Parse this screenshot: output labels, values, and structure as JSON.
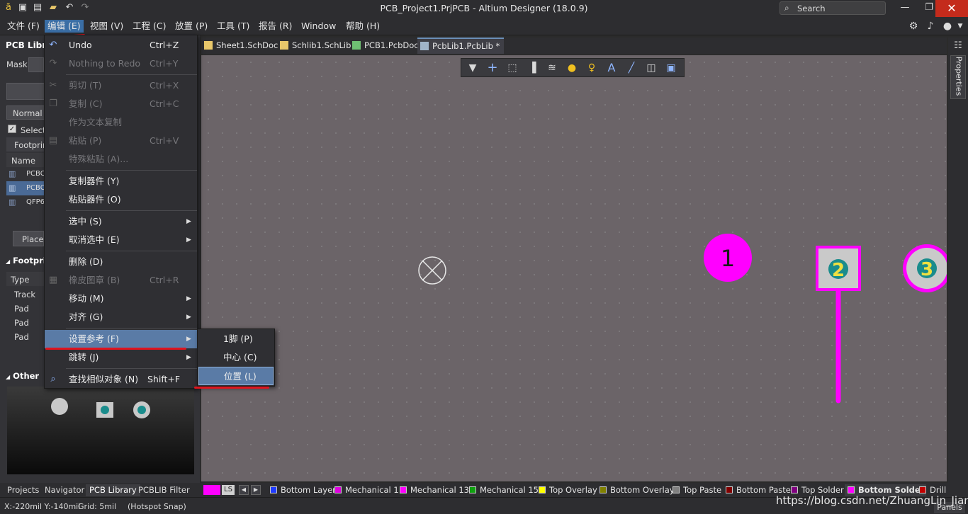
{
  "window": {
    "title": "PCB_Project1.PrjPCB - Altium Designer (18.0.9)",
    "search_placeholder": "Search",
    "minimize": "—",
    "maximize": "❐",
    "close": "✕"
  },
  "menubar": {
    "items": [
      {
        "label": "文件 (F)"
      },
      {
        "label": "编辑 (E)"
      },
      {
        "label": "视图 (V)"
      },
      {
        "label": "工程 (C)"
      },
      {
        "label": "放置 (P)"
      },
      {
        "label": "工具 (T)"
      },
      {
        "label": "报告 (R)"
      },
      {
        "label": "Window"
      },
      {
        "label": "帮助 (H)"
      }
    ]
  },
  "left_panel": {
    "title": "PCB Libra",
    "mask_label": "Mask",
    "normal_label": "Normal",
    "select_label": "Select",
    "footprints_header": "Footprin",
    "name_col": "Name",
    "footprints": [
      "PCBC",
      "PCBC",
      "QFP6"
    ],
    "place_button": "Place",
    "footprint_prims_title": "Footprin",
    "type_col": "Type",
    "primitives": [
      "Track",
      "Pad",
      "Pad",
      "Pad"
    ],
    "other_title": "Other"
  },
  "doc_tabs": [
    {
      "label": "Sheet1.SchDoc",
      "color": "#e8c76a"
    },
    {
      "label": "Schlib1.SchLib",
      "color": "#e8c76a"
    },
    {
      "label": "PCB1.PcbDoc",
      "color": "#6fbf73"
    },
    {
      "label": "PcbLib1.PcbLib *",
      "color": "#a0b4c8"
    }
  ],
  "edit_menu": {
    "items": [
      {
        "label": "Undo",
        "shortcut": "Ctrl+Z",
        "icon": "undo-icon",
        "disabled": false
      },
      {
        "label": "Nothing to Redo",
        "shortcut": "Ctrl+Y",
        "icon": "redo-icon",
        "disabled": true
      },
      {
        "label": "剪切 (T)",
        "shortcut": "Ctrl+X",
        "icon": "cut-icon",
        "disabled": true
      },
      {
        "label": "复制 (C)",
        "shortcut": "Ctrl+C",
        "icon": "copy-icon",
        "disabled": true
      },
      {
        "label": "作为文本复制",
        "shortcut": "",
        "disabled": true
      },
      {
        "label": "粘贴 (P)",
        "shortcut": "Ctrl+V",
        "icon": "paste-icon",
        "disabled": true
      },
      {
        "label": "特殊粘贴 (A)...",
        "shortcut": "",
        "disabled": true
      },
      {
        "label": "复制器件 (Y)",
        "shortcut": "",
        "disabled": false
      },
      {
        "label": "粘贴器件 (O)",
        "shortcut": "",
        "disabled": false
      },
      {
        "label": "选中 (S)",
        "shortcut": "",
        "submenu": true,
        "disabled": false
      },
      {
        "label": "取消选中 (E)",
        "shortcut": "",
        "submenu": true,
        "disabled": false
      },
      {
        "label": "删除 (D)",
        "shortcut": "",
        "disabled": false
      },
      {
        "label": "橡皮图章 (B)",
        "shortcut": "Ctrl+R",
        "icon": "stamp-icon",
        "disabled": true
      },
      {
        "label": "移动 (M)",
        "shortcut": "",
        "submenu": true,
        "disabled": false
      },
      {
        "label": "对齐 (G)",
        "shortcut": "",
        "submenu": true,
        "disabled": false
      },
      {
        "label": "设置参考 (F)",
        "shortcut": "",
        "submenu": true,
        "disabled": false
      },
      {
        "label": "跳转 (J)",
        "shortcut": "",
        "submenu": true,
        "disabled": false
      },
      {
        "label": "查找相似对象 (N)",
        "shortcut": "Shift+F",
        "icon": "find-similar-icon",
        "disabled": false
      }
    ]
  },
  "submenu": {
    "items": [
      {
        "label": "1脚 (P)"
      },
      {
        "label": "中心 (C)"
      },
      {
        "label": "位置 (L)"
      }
    ]
  },
  "canvas": {
    "pad1_label": "1",
    "pad2_label": "2",
    "pad3_label": "3",
    "pad_color": "#ff00ff"
  },
  "bottom_tabs": [
    "Projects",
    "Navigator",
    "PCB Library",
    "PCBLIB Filter"
  ],
  "layers": {
    "current": "LS",
    "items": [
      {
        "label": "Bottom Layer",
        "color": "#1f3bff"
      },
      {
        "label": "Mechanical 1",
        "color": "#e000e0"
      },
      {
        "label": "Mechanical 13",
        "color": "#ff00ff"
      },
      {
        "label": "Mechanical 15",
        "color": "#10a010"
      },
      {
        "label": "Top Overlay",
        "color": "#ffff00"
      },
      {
        "label": "Bottom Overlay",
        "color": "#808000"
      },
      {
        "label": "Top Paste",
        "color": "#808080"
      },
      {
        "label": "Bottom Paste",
        "color": "#800000"
      },
      {
        "label": "Top Solder",
        "color": "#800080"
      },
      {
        "label": "Bottom Solder",
        "color": "#ff00ff"
      },
      {
        "label": "Drill",
        "color": "#c00000"
      }
    ]
  },
  "status": {
    "coords": "X:-220mil Y:-140mil",
    "grid": "Grid: 5mil",
    "snap": "(Hotspot Snap)",
    "panels": "Panels"
  },
  "watermark": "https://blog.csdn.net/ZhuangLin_Jian"
}
